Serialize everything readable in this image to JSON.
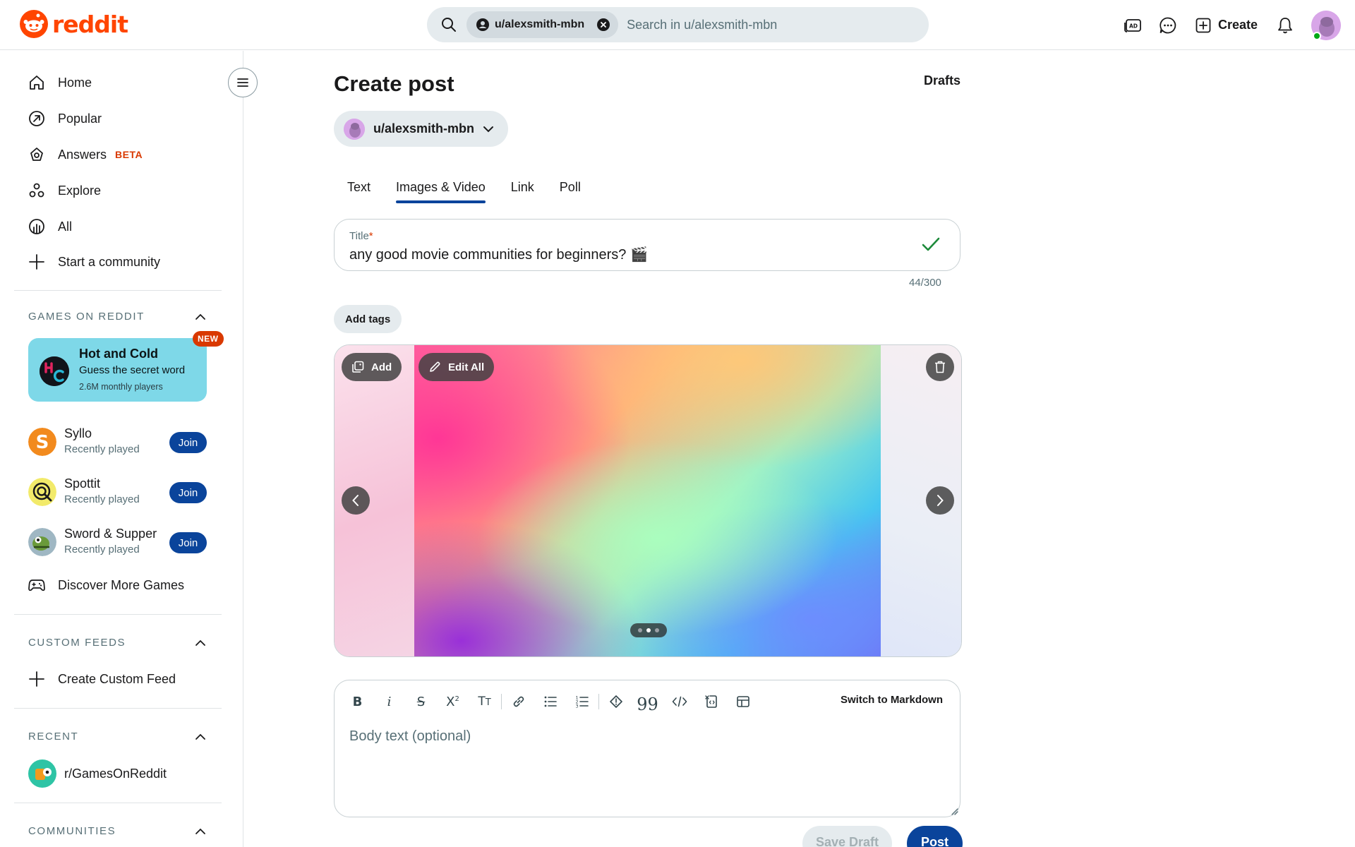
{
  "header": {
    "logo_text": "reddit",
    "search_chip": "u/alexsmith-mbn",
    "search_placeholder": "Search in u/alexsmith-mbn",
    "create_label": "Create",
    "icons": [
      "ads-icon",
      "chat-icon",
      "create-icon",
      "notification-icon",
      "avatar"
    ]
  },
  "sidebar": {
    "nav": [
      {
        "label": "Home",
        "icon": "home-icon"
      },
      {
        "label": "Popular",
        "icon": "popular-icon"
      },
      {
        "label": "Answers",
        "icon": "answers-icon",
        "badge": "BETA"
      },
      {
        "label": "Explore",
        "icon": "explore-icon"
      },
      {
        "label": "All",
        "icon": "all-icon"
      },
      {
        "label": "Start a community",
        "icon": "plus-icon"
      }
    ],
    "games_header": "GAMES ON REDDIT",
    "featured_game": {
      "title": "Hot and Cold",
      "desc": "Guess the secret word",
      "players": "2.6M monthly players",
      "badge": "NEW"
    },
    "games": [
      {
        "name": "Syllo",
        "sub": "Recently played",
        "join": "Join"
      },
      {
        "name": "Spottit",
        "sub": "Recently played",
        "join": "Join"
      },
      {
        "name": "Sword & Supper",
        "sub": "Recently played",
        "join": "Join"
      }
    ],
    "discover": "Discover More Games",
    "custom_feeds_header": "CUSTOM FEEDS",
    "create_custom_feed": "Create Custom Feed",
    "recent_header": "RECENT",
    "recent_item": "r/GamesOnReddit",
    "communities_header": "COMMUNITIES"
  },
  "main": {
    "title": "Create post",
    "drafts": "Drafts",
    "community": "u/alexsmith-mbn",
    "tabs": [
      {
        "label": "Text",
        "active": false
      },
      {
        "label": "Images & Video",
        "active": true
      },
      {
        "label": "Link",
        "active": false
      },
      {
        "label": "Poll",
        "active": false
      }
    ],
    "title_field": {
      "label": "Title",
      "required_mark": "*",
      "value": "any good movie communities for beginners? 🎬",
      "count": "44/300"
    },
    "add_tags": "Add tags",
    "media": {
      "add_label": "Add",
      "edit_all_label": "Edit All",
      "dots_total": 3,
      "dot_active": 2
    },
    "editor": {
      "switch_markdown": "Switch to Markdown",
      "body_placeholder": "Body text (optional)"
    },
    "save_draft": "Save Draft",
    "post": "Post"
  },
  "colors": {
    "brand": "#ff4500",
    "primary": "#0a449b",
    "chip_bg": "#e5ebee",
    "game_card": "#7ed8e8",
    "new_badge": "#d93900"
  }
}
